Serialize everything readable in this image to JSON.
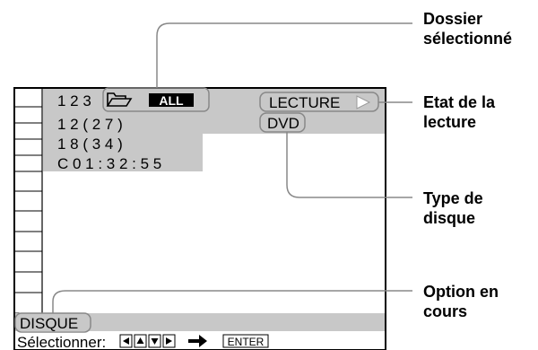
{
  "screen": {
    "rows": [
      {
        "num": "1 2 3",
        "badge": "ALL"
      },
      {
        "text": "1 2 ( 2 7 )"
      },
      {
        "text": "1 8 ( 3 4 )"
      },
      {
        "text": "C  0 1 : 3 2 : 5 5"
      }
    ],
    "status_label": "LECTURE",
    "disc_type": "DVD",
    "current_option": "DISQUE",
    "footer": {
      "prefix": "Sélectionner:",
      "enter": "ENTER"
    },
    "colors": {
      "panel": "#c8c8c8",
      "frame": "#000000",
      "grey": "#999999"
    }
  },
  "callouts": {
    "folder": [
      "Dossier",
      "sélectionné"
    ],
    "playback_state": [
      "Etat de la",
      "lecture"
    ],
    "disc_type": [
      "Type de",
      "disque"
    ],
    "current_option": [
      "Option en",
      "cours"
    ]
  }
}
